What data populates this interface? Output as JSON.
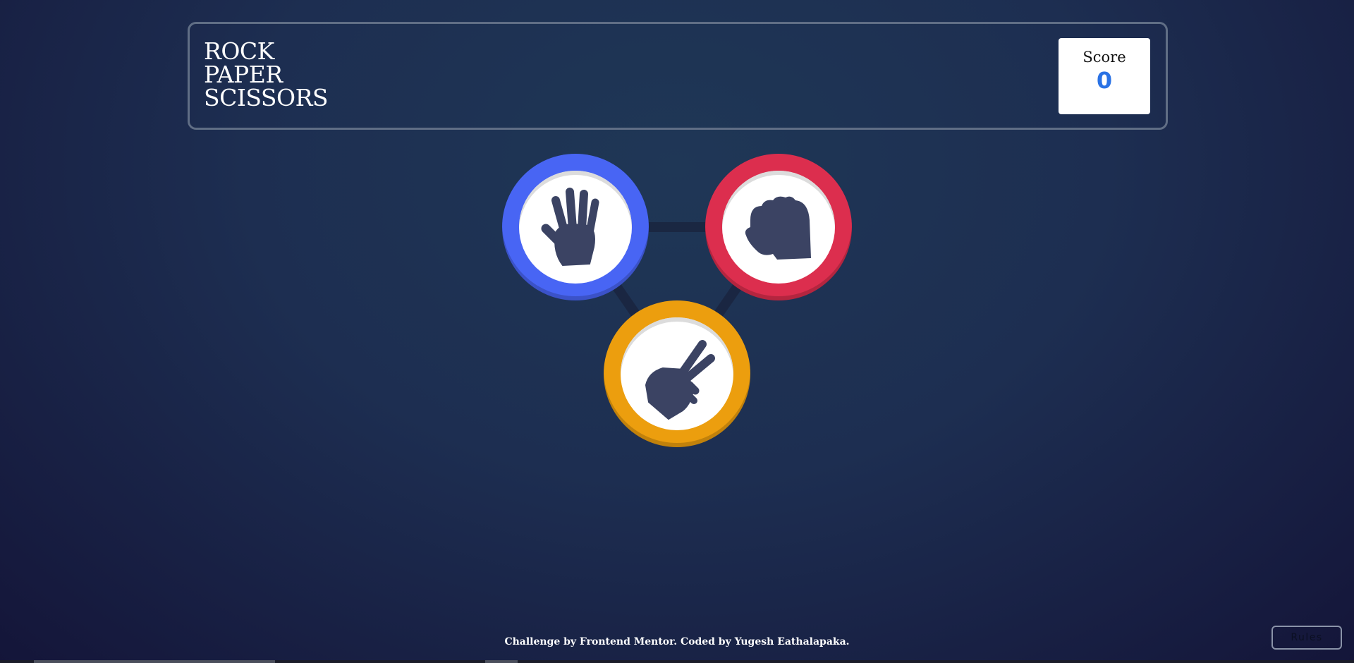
{
  "header": {
    "title_lines": [
      "ROCK",
      "PAPER",
      "SCISSORS"
    ],
    "score_label": "Score",
    "score_value": "0"
  },
  "choices": [
    {
      "id": "paper",
      "icon": "hand-paper-icon",
      "color": "#4865f4"
    },
    {
      "id": "rock",
      "icon": "hand-rock-icon",
      "color": "#dc2e4e"
    },
    {
      "id": "scissors",
      "icon": "hand-scissors-icon",
      "color": "#ec9e0e"
    }
  ],
  "footer": {
    "attribution": "Challenge by Frontend Mentor. Coded by Yugesh Eathalapaka."
  },
  "rules_button": {
    "label": "Rules"
  },
  "colors": {
    "background": "#1f3756",
    "score_value": "#2a72e5",
    "icon_fill": "#3b4363",
    "header_border": "#606e85"
  }
}
